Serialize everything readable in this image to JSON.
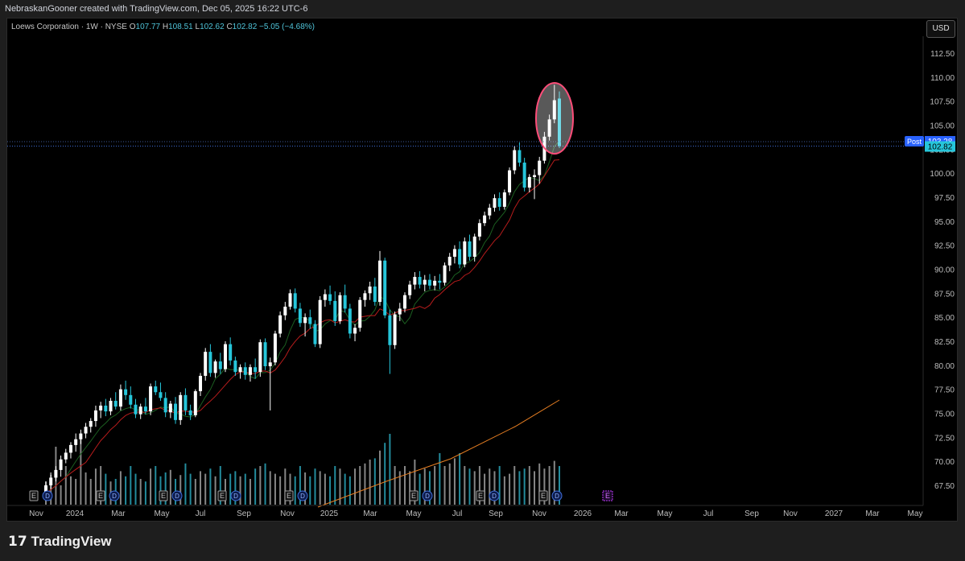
{
  "header": {
    "attribution": "NebraskanGooner created with TradingView.com, Dec 05, 2025 16:22 UTC-6"
  },
  "legend": {
    "symbol": "Loews Corporation · 1W · NYSE",
    "open_label": "O",
    "open": "107.77",
    "high_label": "H",
    "high": "108.51",
    "low_label": "L",
    "low": "102.62",
    "close_label": "C",
    "close": "102.82",
    "change": "−5.05 (−4.68%)"
  },
  "currency": "USD",
  "footer": {
    "brand": "TradingView"
  },
  "colors": {
    "up": "#ffffff",
    "down": "#26c6da",
    "ma_short": "#1b5e20",
    "ma_mid": "#b71c1c",
    "ma_long": "#e67e22",
    "highlight": "#ff4d79",
    "grid": "#000000",
    "price_line": "#3f6ed8"
  },
  "chart_data": {
    "type": "candlestick",
    "x_ticks": [
      "Nov",
      "2024",
      "Mar",
      "May",
      "Jul",
      "Sep",
      "Nov",
      "2025",
      "Mar",
      "May",
      "Jul",
      "Sep",
      "Nov",
      "2026",
      "Mar",
      "May",
      "Jul",
      "Sep",
      "Nov",
      "2027",
      "Mar",
      "May"
    ],
    "y_ticks": [
      "67.50",
      "70.00",
      "72.50",
      "75.00",
      "77.50",
      "80.00",
      "82.50",
      "85.00",
      "87.50",
      "90.00",
      "92.50",
      "95.00",
      "97.50",
      "100.00",
      "102.50",
      "105.00",
      "107.50",
      "110.00",
      "112.50"
    ],
    "ylim": [
      65.3,
      116.2
    ],
    "post_label": "Post",
    "post_price": "103.28",
    "last_price": "102.82",
    "earnings_marker": "E",
    "dividend_marker": "D",
    "candles": [
      [
        66.6,
        67.9,
        66.3,
        67.5
      ],
      [
        67.5,
        68.6,
        67.1,
        68.3
      ],
      [
        68.3,
        69.5,
        67.9,
        69.1
      ],
      [
        69.1,
        70.6,
        68.4,
        70.2
      ],
      [
        70.2,
        71.3,
        69.8,
        70.9
      ],
      [
        70.9,
        72.0,
        70.3,
        71.7
      ],
      [
        71.7,
        72.9,
        71.0,
        72.3
      ],
      [
        72.3,
        73.3,
        71.8,
        72.9
      ],
      [
        72.9,
        74.0,
        72.4,
        73.6
      ],
      [
        73.6,
        74.5,
        73.0,
        74.2
      ],
      [
        74.2,
        75.8,
        73.6,
        75.3
      ],
      [
        75.3,
        76.2,
        74.5,
        75.8
      ],
      [
        75.8,
        76.5,
        74.7,
        75.2
      ],
      [
        75.2,
        76.6,
        74.8,
        76.3
      ],
      [
        76.3,
        77.2,
        75.4,
        75.7
      ],
      [
        75.7,
        78.0,
        75.3,
        77.5
      ],
      [
        77.5,
        78.4,
        76.4,
        76.9
      ],
      [
        76.9,
        77.8,
        75.5,
        75.9
      ],
      [
        75.9,
        76.5,
        74.5,
        74.9
      ],
      [
        74.9,
        76.0,
        74.4,
        75.7
      ],
      [
        75.7,
        76.6,
        74.9,
        75.2
      ],
      [
        75.2,
        78.1,
        74.8,
        77.8
      ],
      [
        77.8,
        78.4,
        76.9,
        77.2
      ],
      [
        77.2,
        78.2,
        76.3,
        76.6
      ],
      [
        76.6,
        77.2,
        74.6,
        75.1
      ],
      [
        75.1,
        76.3,
        74.5,
        76.0
      ],
      [
        76.0,
        76.7,
        73.9,
        74.3
      ],
      [
        74.3,
        77.2,
        73.8,
        76.9
      ],
      [
        76.9,
        77.6,
        74.8,
        75.3
      ],
      [
        75.3,
        75.9,
        74.3,
        74.8
      ],
      [
        74.8,
        77.5,
        74.6,
        77.3
      ],
      [
        77.3,
        79.2,
        76.8,
        78.9
      ],
      [
        78.9,
        81.8,
        78.4,
        81.4
      ],
      [
        81.4,
        82.2,
        78.8,
        79.2
      ],
      [
        79.2,
        80.6,
        78.7,
        80.4
      ],
      [
        80.4,
        81.3,
        79.1,
        79.6
      ],
      [
        79.6,
        82.5,
        79.3,
        82.2
      ],
      [
        82.2,
        82.9,
        80.0,
        80.5
      ],
      [
        80.5,
        80.9,
        78.9,
        79.3
      ],
      [
        79.3,
        80.1,
        78.6,
        79.8
      ],
      [
        79.8,
        80.3,
        78.5,
        79.0
      ],
      [
        79.0,
        80.1,
        78.3,
        79.8
      ],
      [
        79.8,
        80.7,
        78.6,
        79.3
      ],
      [
        79.3,
        82.7,
        78.8,
        82.4
      ],
      [
        82.4,
        82.8,
        79.5,
        79.9
      ],
      [
        79.9,
        80.8,
        75.3,
        80.3
      ],
      [
        80.3,
        83.6,
        80.0,
        83.3
      ],
      [
        83.3,
        85.6,
        82.9,
        85.2
      ],
      [
        85.2,
        86.6,
        84.7,
        86.1
      ],
      [
        86.1,
        87.9,
        85.8,
        87.5
      ],
      [
        87.5,
        88.0,
        85.5,
        85.9
      ],
      [
        85.9,
        86.5,
        84.0,
        84.4
      ],
      [
        84.4,
        85.4,
        83.0,
        85.0
      ],
      [
        85.0,
        85.8,
        83.8,
        84.3
      ],
      [
        84.3,
        84.7,
        81.9,
        82.2
      ],
      [
        82.2,
        87.2,
        81.8,
        86.8
      ],
      [
        86.8,
        87.9,
        86.1,
        87.4
      ],
      [
        87.4,
        88.3,
        86.3,
        86.7
      ],
      [
        86.7,
        87.7,
        84.1,
        84.6
      ],
      [
        84.6,
        87.6,
        84.3,
        87.3
      ],
      [
        87.3,
        88.4,
        85.5,
        85.9
      ],
      [
        85.9,
        86.4,
        82.8,
        83.3
      ],
      [
        83.3,
        84.3,
        82.5,
        83.9
      ],
      [
        83.9,
        87.1,
        83.5,
        86.8
      ],
      [
        86.8,
        87.8,
        86.1,
        87.5
      ],
      [
        87.5,
        88.7,
        86.8,
        88.2
      ],
      [
        88.2,
        89.1,
        86.2,
        86.6
      ],
      [
        86.6,
        91.9,
        86.2,
        90.9
      ],
      [
        90.9,
        91.2,
        84.9,
        85.2
      ],
      [
        85.2,
        85.8,
        79.1,
        82.1
      ],
      [
        82.1,
        85.6,
        81.7,
        85.3
      ],
      [
        85.3,
        86.5,
        84.6,
        85.9
      ],
      [
        85.9,
        87.6,
        85.5,
        87.3
      ],
      [
        87.3,
        88.8,
        86.9,
        88.4
      ],
      [
        88.4,
        89.7,
        87.9,
        89.2
      ],
      [
        89.2,
        89.8,
        88.0,
        88.4
      ],
      [
        88.4,
        89.4,
        87.7,
        88.9
      ],
      [
        88.9,
        89.5,
        87.9,
        88.3
      ],
      [
        88.3,
        89.3,
        87.8,
        88.8
      ],
      [
        88.8,
        89.5,
        87.9,
        88.6
      ],
      [
        88.6,
        90.7,
        88.3,
        90.4
      ],
      [
        90.4,
        91.7,
        89.8,
        91.3
      ],
      [
        91.3,
        92.5,
        90.6,
        92.1
      ],
      [
        92.1,
        92.9,
        90.1,
        90.5
      ],
      [
        90.5,
        93.3,
        90.2,
        92.9
      ],
      [
        92.9,
        93.6,
        90.9,
        91.3
      ],
      [
        91.3,
        93.7,
        90.8,
        93.4
      ],
      [
        93.4,
        95.2,
        93.0,
        94.8
      ],
      [
        94.8,
        96.0,
        94.5,
        95.6
      ],
      [
        95.6,
        96.8,
        95.2,
        96.4
      ],
      [
        96.4,
        97.8,
        96.0,
        97.4
      ],
      [
        97.4,
        98.0,
        96.1,
        96.5
      ],
      [
        96.5,
        98.3,
        96.2,
        98.0
      ],
      [
        98.0,
        100.6,
        97.7,
        100.3
      ],
      [
        100.3,
        102.8,
        99.9,
        102.4
      ],
      [
        102.4,
        103.2,
        100.7,
        101.1
      ],
      [
        101.1,
        101.6,
        98.1,
        98.5
      ],
      [
        98.5,
        99.9,
        98.0,
        99.6
      ],
      [
        99.6,
        100.4,
        97.3,
        99.8
      ],
      [
        99.8,
        101.7,
        98.9,
        101.3
      ],
      [
        101.3,
        104.3,
        101.0,
        103.8
      ],
      [
        103.8,
        106.1,
        103.4,
        105.6
      ],
      [
        105.6,
        109.2,
        105.2,
        107.6
      ],
      [
        107.77,
        108.51,
        102.62,
        102.82
      ]
    ],
    "volume_relative": [
      0.18,
      0.25,
      0.45,
      0.15,
      0.3,
      0.22,
      0.2,
      0.55,
      0.25,
      0.2,
      0.28,
      0.3,
      0.24,
      0.18,
      0.2,
      0.26,
      0.22,
      0.3,
      0.24,
      0.2,
      0.18,
      0.28,
      0.3,
      0.22,
      0.25,
      0.27,
      0.2,
      0.23,
      0.32,
      0.24,
      0.2,
      0.26,
      0.24,
      0.28,
      0.22,
      0.3,
      0.2,
      0.24,
      0.26,
      0.22,
      0.24,
      0.2,
      0.28,
      0.3,
      0.32,
      0.26,
      0.24,
      0.22,
      0.28,
      0.24,
      0.22,
      0.3,
      0.25,
      0.22,
      0.28,
      0.26,
      0.24,
      0.22,
      0.3,
      0.28,
      0.24,
      0.22,
      0.28,
      0.3,
      0.32,
      0.35,
      0.36,
      0.42,
      0.48,
      0.55,
      0.3,
      0.26,
      0.3,
      0.26,
      0.35,
      0.24,
      0.28,
      0.26,
      0.3,
      0.4,
      0.3,
      0.32,
      0.36,
      0.4,
      0.3,
      0.28,
      0.26,
      0.3,
      0.24,
      0.28,
      0.26,
      0.3,
      0.22,
      0.24,
      0.3,
      0.26,
      0.28,
      0.3,
      0.26,
      0.32,
      0.28,
      0.3,
      0.34,
      0.3
    ]
  }
}
